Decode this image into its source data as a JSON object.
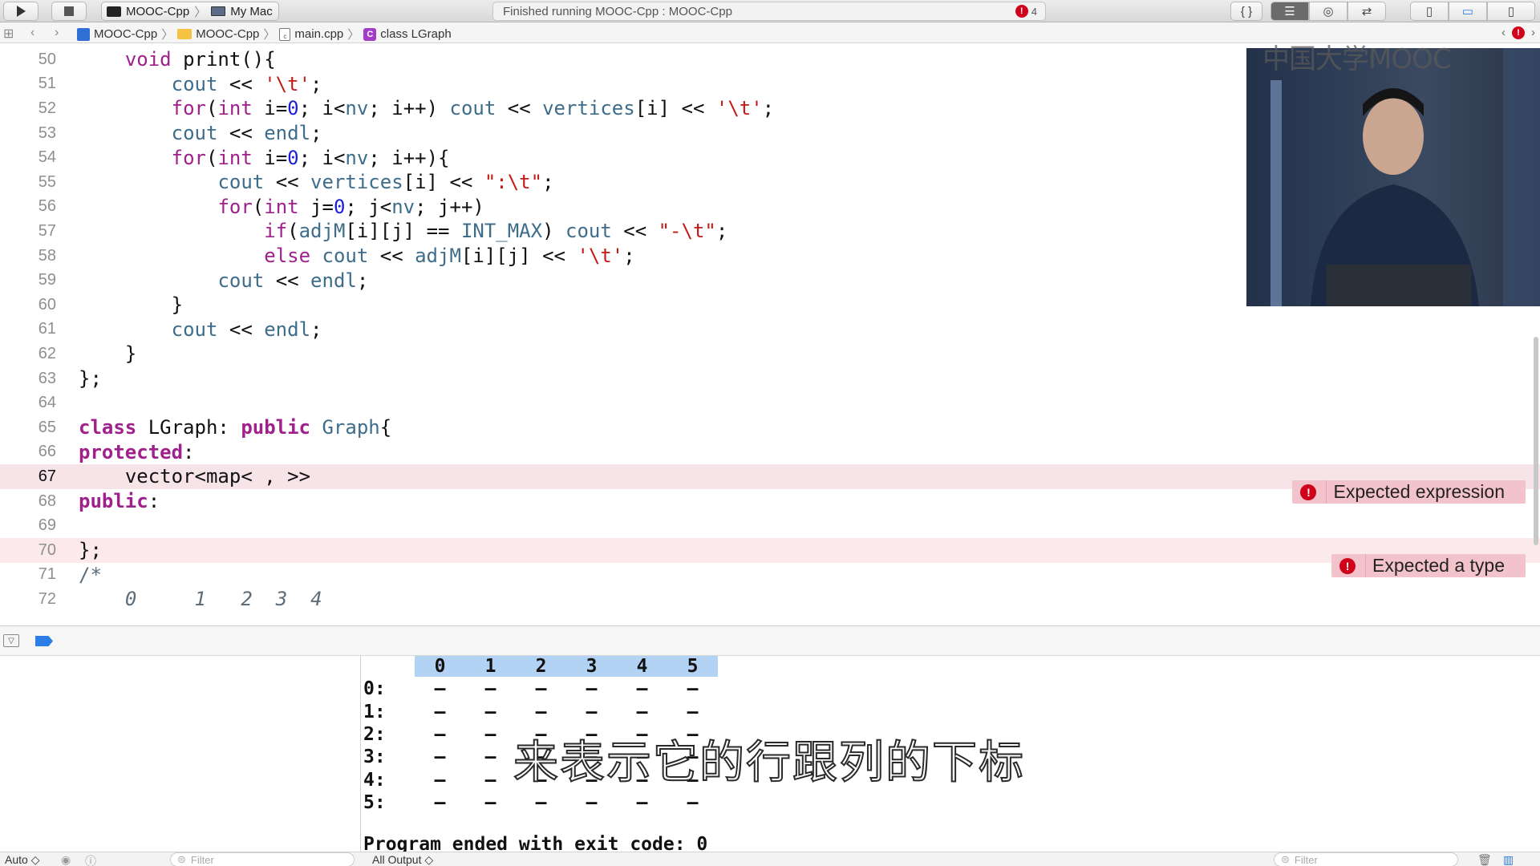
{
  "toolbar": {
    "scheme": "MOOC-Cpp",
    "destination": "My Mac",
    "status": "Finished running MOOC-Cpp : MOOC-Cpp",
    "error_count": "4"
  },
  "jumpbar": {
    "crumbs": [
      "MOOC-Cpp",
      "MOOC-Cpp",
      "main.cpp",
      "class LGraph"
    ]
  },
  "editor": {
    "lines": [
      {
        "num": "50",
        "code": "    void print(){"
      },
      {
        "num": "51",
        "code": "        cout << '\\t';"
      },
      {
        "num": "52",
        "code": "        for(int i=0; i<nv; i++) cout << vertices[i] << '\\t';"
      },
      {
        "num": "53",
        "code": "        cout << endl;"
      },
      {
        "num": "54",
        "code": "        for(int i=0; i<nv; i++){"
      },
      {
        "num": "55",
        "code": "            cout << vertices[i] << \":\\t\";"
      },
      {
        "num": "56",
        "code": "            for(int j=0; j<nv; j++)"
      },
      {
        "num": "57",
        "code": "                if(adjM[i][j] == INT_MAX) cout << \"-\\t\";"
      },
      {
        "num": "58",
        "code": "                else cout << adjM[i][j] << '\\t';"
      },
      {
        "num": "59",
        "code": "            cout << endl;"
      },
      {
        "num": "60",
        "code": "        }"
      },
      {
        "num": "61",
        "code": "        cout << endl;"
      },
      {
        "num": "62",
        "code": "    }"
      },
      {
        "num": "63",
        "code": "};"
      },
      {
        "num": "64",
        "code": ""
      },
      {
        "num": "65",
        "code": "class LGraph: public Graph{"
      },
      {
        "num": "66",
        "code": "protected:"
      },
      {
        "num": "67",
        "code": "    vector<map< , >>"
      },
      {
        "num": "68",
        "code": "public:"
      },
      {
        "num": "69",
        "code": ""
      },
      {
        "num": "70",
        "code": "};"
      },
      {
        "num": "71",
        "code": "/*"
      },
      {
        "num": "72",
        "code": "    0     1   2  3  4"
      }
    ],
    "errors": {
      "line67": "Expected expression",
      "line70": "Expected a type"
    },
    "watermark": "中国大学MOOC"
  },
  "console": {
    "header": [
      "0",
      "1",
      "2",
      "3",
      "4",
      "5"
    ],
    "rows": [
      {
        "label": "0:",
        "cells": [
          "–",
          "–",
          "–",
          "–",
          "–",
          "–"
        ]
      },
      {
        "label": "1:",
        "cells": [
          "–",
          "–",
          "–",
          "–",
          "–",
          "–"
        ]
      },
      {
        "label": "2:",
        "cells": [
          "–",
          "–",
          "–",
          "–",
          "–",
          "–"
        ]
      },
      {
        "label": "3:",
        "cells": [
          "–",
          "–",
          "–",
          "–",
          "–",
          "–"
        ]
      },
      {
        "label": "4:",
        "cells": [
          "–",
          "–",
          "–",
          "–",
          "–",
          "–"
        ]
      },
      {
        "label": "5:",
        "cells": [
          "–",
          "–",
          "–",
          "–",
          "–",
          "–"
        ]
      }
    ],
    "ended": "Program ended with exit code: 0"
  },
  "subtitle": "来表示它的行跟列的下标",
  "filterbar": {
    "auto_label": "Auto ◇",
    "filter_placeholder": "Filter",
    "output_label": "All Output ◇",
    "filter2_placeholder": "Filter"
  },
  "colors": {
    "keyword": "#a0208c",
    "type_ref": "#3e6d8c",
    "number": "#1c1fd6",
    "string": "#c41a16",
    "error_line": "#fbe9ec",
    "selection": "#b3d3f5"
  }
}
